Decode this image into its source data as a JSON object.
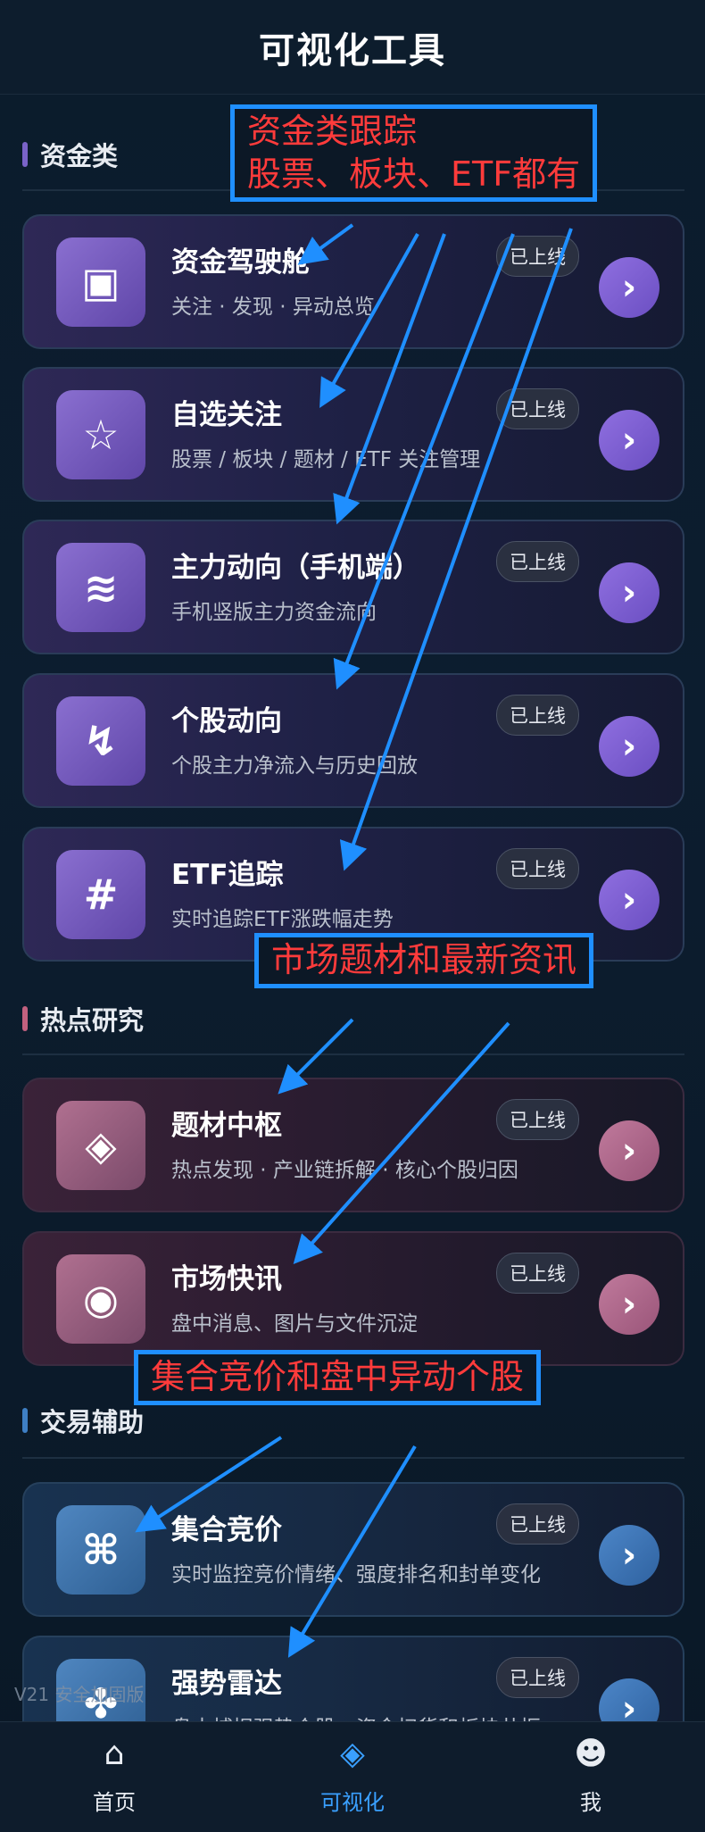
{
  "header": {
    "title": "可视化工具"
  },
  "sections": [
    {
      "label": "资金类",
      "color": "#7a63c8"
    },
    {
      "label": "热点研究",
      "color": "#c2617f"
    },
    {
      "label": "交易辅助",
      "color": "#3e7fc4"
    }
  ],
  "cards": [
    {
      "title": "资金驾驶舱",
      "subtitle": "关注 · 发现 · 异动总览",
      "badge": "已上线",
      "icon": "▣",
      "icon_name": "square-target-icon",
      "go": "›"
    },
    {
      "title": "自选关注",
      "subtitle": "股票 / 板块 / 题材 / ETF 关注管理",
      "badge": "已上线",
      "icon": "☆",
      "icon_name": "star-icon",
      "go": "›"
    },
    {
      "title": "主力动向（手机端）",
      "subtitle": "手机竖版主力资金流向",
      "badge": "已上线",
      "icon": "≋",
      "icon_name": "wave-icon",
      "go": "›"
    },
    {
      "title": "个股动向",
      "subtitle": "个股主力净流入与历史回放",
      "badge": "已上线",
      "icon": "↯",
      "icon_name": "zigzag-arrow-icon",
      "go": "›"
    },
    {
      "title": "ETF追踪",
      "subtitle": "实时追踪ETF涨跌幅走势",
      "badge": "已上线",
      "icon": "#",
      "icon_name": "hash-icon",
      "go": "›"
    },
    {
      "title": "题材中枢",
      "subtitle": "热点发现 · 产业链拆解 · 核心个股归因",
      "badge": "已上线",
      "icon": "◈",
      "icon_name": "diamond-icon",
      "go": "›"
    },
    {
      "title": "市场快讯",
      "subtitle": "盘中消息、图片与文件沉淀",
      "badge": "已上线",
      "icon": "◉",
      "icon_name": "radio-dot-icon",
      "go": "›"
    },
    {
      "title": "集合竞价",
      "subtitle": "实时监控竞价情绪、强度排名和封单变化",
      "badge": "已上线",
      "icon": "⌘",
      "icon_name": "command-icon",
      "go": "›"
    },
    {
      "title": "强势雷达",
      "subtitle": "盘中捕捉强势个股、资金扫货和板块共振",
      "badge": "已上线",
      "icon": "✤",
      "icon_name": "radar-flower-icon",
      "go": "›"
    }
  ],
  "annotations": [
    {
      "lines": [
        "资金类跟踪",
        "股票、板块、ETF都有"
      ]
    },
    {
      "lines": [
        "市场题材和最新资讯"
      ]
    },
    {
      "lines": [
        "集合竞价和盘中异动个股"
      ]
    }
  ],
  "watermark": "V21 安全加固版",
  "nav": [
    {
      "label": "首页",
      "icon": "⌂",
      "active": false
    },
    {
      "label": "可视化",
      "icon": "◈",
      "active": true
    },
    {
      "label": "我",
      "icon": "☻",
      "active": false
    }
  ],
  "colors": {
    "arrow": "#1f8fff",
    "note_text": "#ff3b3b",
    "active": "#3aa0ff"
  }
}
